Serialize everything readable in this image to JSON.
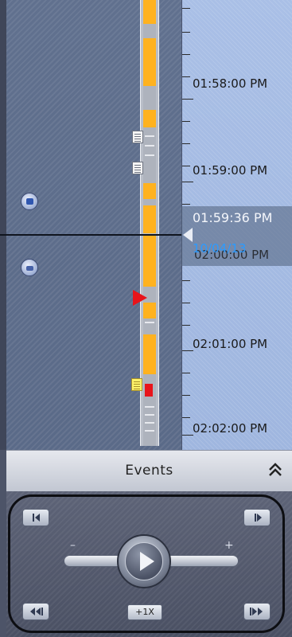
{
  "timeline": {
    "time_labels": [
      "01:58:00 PM",
      "01:59:00 PM",
      "02:01:00 PM",
      "02:02:00 PM"
    ],
    "ghost_label": "02:00:00 PM",
    "cursor": {
      "time": "01:59:36 PM",
      "date": "10/04/13"
    }
  },
  "events_bar": {
    "label": "Events",
    "chevron_icon": "double-chevron-up-icon"
  },
  "playback": {
    "minus_label": "–",
    "plus_label": "+",
    "speed_label": "+1X",
    "step_back_label": "◀▏",
    "step_forward_label": "▕▶",
    "skip_back_label": "◀◀▏",
    "skip_forward_label": "▕▶▶"
  },
  "colors": {
    "track_orange": "#ffb21f",
    "cursor_date": "#2c9bff",
    "flag_red": "#e8141b"
  }
}
